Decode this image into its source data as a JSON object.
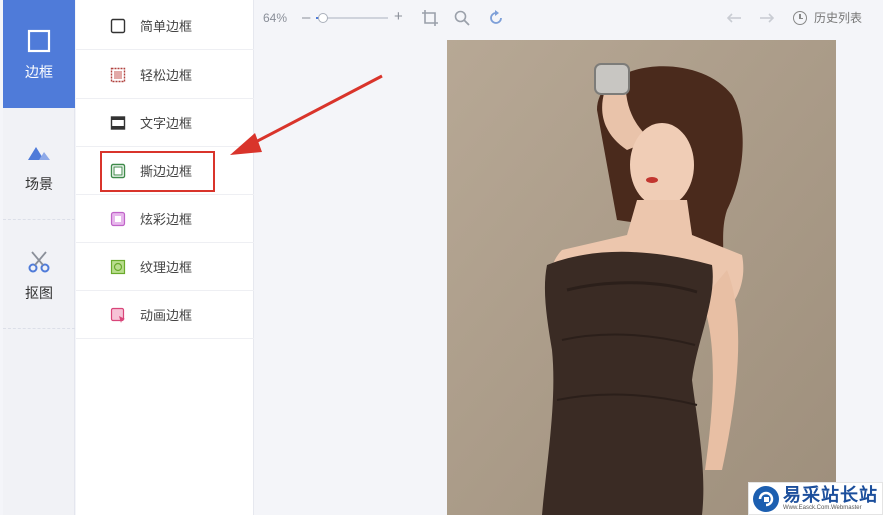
{
  "rail": {
    "items": [
      {
        "label": "边框",
        "icon": "frame-icon",
        "active": true
      },
      {
        "label": "场景",
        "icon": "mountain-icon",
        "active": false
      },
      {
        "label": "抠图",
        "icon": "scissors-icon",
        "active": false
      }
    ]
  },
  "submenu": {
    "items": [
      {
        "label": "简单边框",
        "icon": "simple-frame-icon",
        "color": "#333333"
      },
      {
        "label": "轻松边框",
        "icon": "easy-frame-icon",
        "color": "#b0413e"
      },
      {
        "label": "文字边框",
        "icon": "text-frame-icon",
        "color": "#333333"
      },
      {
        "label": "撕边边框",
        "icon": "torn-frame-icon",
        "color": "#3f8a4a"
      },
      {
        "label": "炫彩边框",
        "icon": "colorful-frame-icon",
        "color": "#c064c8"
      },
      {
        "label": "纹理边框",
        "icon": "texture-frame-icon",
        "color": "#6aaa2c"
      },
      {
        "label": "动画边框",
        "icon": "animated-frame-icon",
        "color": "#d9467a"
      }
    ],
    "highlighted_index": 3
  },
  "toolbar": {
    "zoom_label": "64%",
    "zoom_level": 0.1,
    "history_label": "历史列表"
  },
  "watermark": {
    "name": "易采站长站",
    "url": "Www.Easck.Com.Webmaster"
  },
  "colors": {
    "accent": "#4f7bd9",
    "highlight": "#d9342b"
  }
}
